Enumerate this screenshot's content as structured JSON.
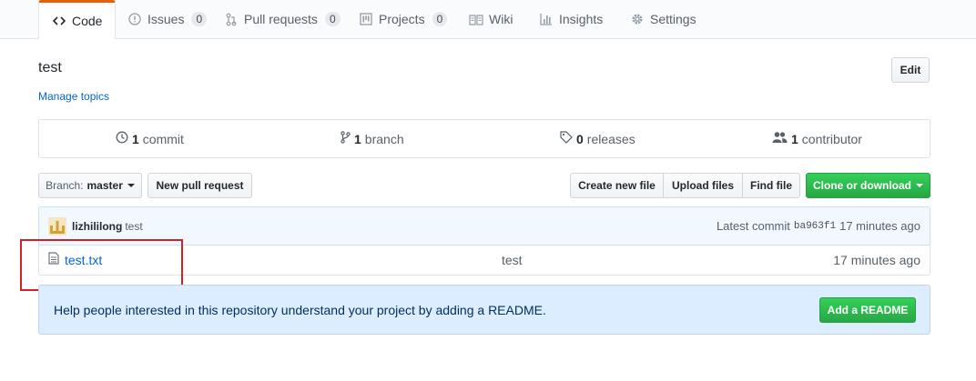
{
  "tabs": [
    {
      "label": "Code",
      "icon": "code-icon"
    },
    {
      "label": "Issues",
      "icon": "issue-icon",
      "count": "0"
    },
    {
      "label": "Pull requests",
      "icon": "pull-request-icon",
      "count": "0"
    },
    {
      "label": "Projects",
      "icon": "project-icon",
      "count": "0"
    },
    {
      "label": "Wiki",
      "icon": "book-icon"
    },
    {
      "label": "Insights",
      "icon": "graph-icon"
    },
    {
      "label": "Settings",
      "icon": "gear-icon"
    }
  ],
  "repo": {
    "description": "test",
    "manage_topics": "Manage topics",
    "edit_label": "Edit"
  },
  "summary": {
    "commits": {
      "num": "1",
      "label": "commit"
    },
    "branches": {
      "num": "1",
      "label": "branch"
    },
    "releases": {
      "num": "0",
      "label": "releases"
    },
    "contributors": {
      "num": "1",
      "label": "contributor"
    }
  },
  "toolbar": {
    "branch_prefix": "Branch:",
    "branch_name": "master",
    "new_pull_request": "New pull request",
    "create_new_file": "Create new file",
    "upload_files": "Upload files",
    "find_file": "Find file",
    "clone_or_download": "Clone or download"
  },
  "latest_commit": {
    "author": "lizhililong",
    "message": "test",
    "prefix": "Latest commit",
    "sha": "ba963f1",
    "age": "17 minutes ago"
  },
  "files": [
    {
      "name": "test.txt",
      "message": "test",
      "age": "17 minutes ago"
    }
  ],
  "readme_prompt": {
    "text": "Help people interested in this repository understand your project by adding a README.",
    "button": "Add a README"
  },
  "colors": {
    "accent_tab": "#e36209",
    "link": "#0366d6",
    "green_button": "#28a745",
    "highlight_box": "#d0202a"
  }
}
